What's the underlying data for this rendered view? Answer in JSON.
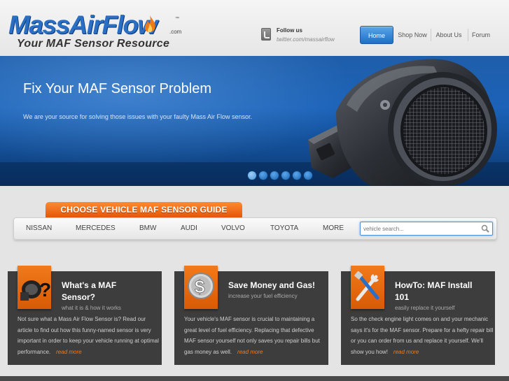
{
  "header": {
    "logo_main": "MassAirFlow",
    "logo_com": ".com",
    "logo_tm": "™",
    "logo_tagline": "Your MAF Sensor Resource",
    "follow_label": "Follow us",
    "twitter_url": "twitter.com/massairflow"
  },
  "nav": {
    "items": [
      {
        "label": "Home",
        "active": true
      },
      {
        "label": "Shop Now",
        "active": false
      },
      {
        "label": "About Us",
        "active": false
      },
      {
        "label": "Forum",
        "active": false
      }
    ]
  },
  "hero": {
    "title": "Fix Your MAF Sensor Problem",
    "text": "We are your source for solving those issues with your faulty Mass Air Flow sensor.",
    "slide_count": 6,
    "active_slide": 1
  },
  "vehicle": {
    "tab_label": "CHOOSE  VEHICLE  MAF SENSOR GUIDE",
    "makes": [
      "NISSAN",
      "MERCEDES",
      "BMW",
      "AUDI",
      "VOLVO",
      "TOYOTA",
      "MORE"
    ],
    "search_placeholder": "vehicle search..."
  },
  "panels": [
    {
      "icon": "question-sensor-icon",
      "title": "What's a MAF Sensor?",
      "subtitle": "what it is & how it works",
      "body": "Not sure what a Mass Air Flow Sensor is? Read our article to find out how this funny-named sensor is very important in order to keep your vehicle running at optimal performance.",
      "link": "read more"
    },
    {
      "icon": "dollar-icon",
      "title": "Save Money and Gas!",
      "subtitle": "increase your fuel efficiency",
      "body": "Your vehicle's MAF sensor is crucial to maintaining a great level of fuel efficiency. Replacing that defective MAF sensor yourself not only saves you repair bills but gas money as well.",
      "link": "read more"
    },
    {
      "icon": "tools-icon",
      "title": "HowTo: MAF Install 101",
      "subtitle": "easily replace it yourself",
      "body": "So the check engine light comes on and your mechanic says it's for the MAF sensor. Prepare for a hefty repair bill or you can order from us and replace it yourself. We'll show you how!",
      "link": "read more"
    }
  ],
  "colors": {
    "accent_orange": "#e8650f",
    "nav_blue": "#1e6fc7",
    "hero_blue": "#1b62b8",
    "panel_dark": "#3d3d3d"
  }
}
